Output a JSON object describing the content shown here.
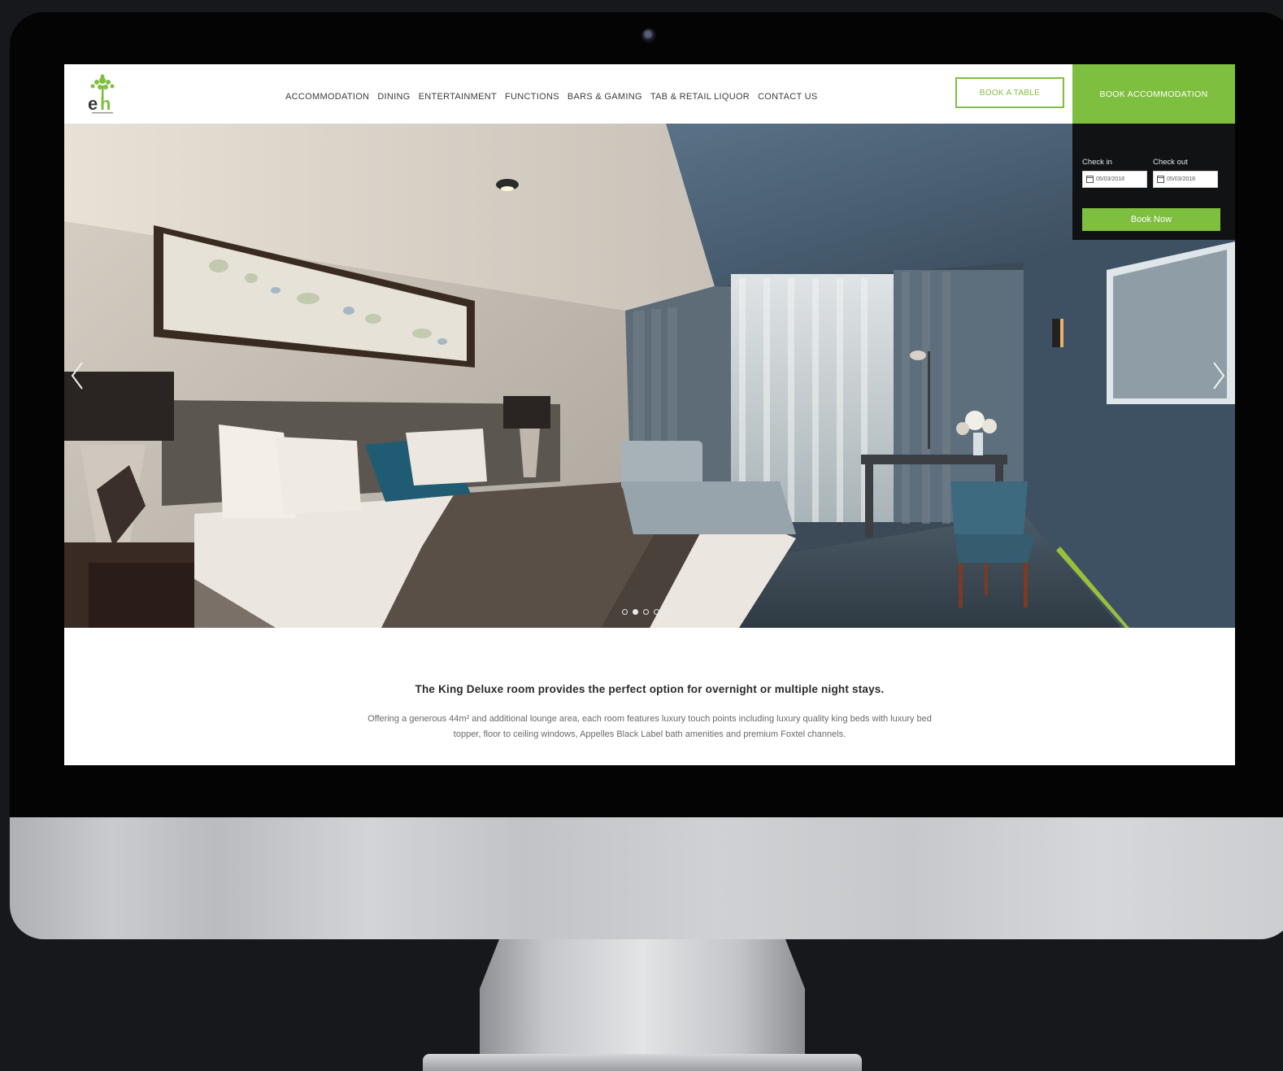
{
  "nav": {
    "items": [
      {
        "label": "ACCOMMODATION"
      },
      {
        "label": "DINING"
      },
      {
        "label": "ENTERTAINMENT"
      },
      {
        "label": "FUNCTIONS"
      },
      {
        "label": "BARS & GAMING"
      },
      {
        "label": "TAB & RETAIL LIQUOR"
      },
      {
        "label": "CONTACT US"
      }
    ]
  },
  "logo": {
    "text": "eh"
  },
  "header": {
    "book_table_label": "BOOK A TABLE",
    "book_accommodation_label": "BOOK ACCOMMODATION"
  },
  "booking": {
    "check_in_label": "Check in",
    "check_out_label": "Check out",
    "check_in_value": "05/03/2018",
    "check_out_value": "05/03/2018",
    "book_now_label": "Book Now"
  },
  "slider": {
    "dot_count": 5,
    "active_dot": 2
  },
  "content": {
    "headline": "The King Deluxe room provides the perfect option for overnight or multiple night stays.",
    "body": "Offering a generous 44m² and additional lounge area, each room features luxury touch points including luxury quality king beds with luxury bed topper, floor to ceiling windows, Appelles Black Label bath amenities and premium Foxtel channels."
  },
  "colors": {
    "accent_green": "#7fbf3f",
    "dark_panel": "#101214"
  },
  "icons": {
    "logo": "tree-logo-icon",
    "prev": "chevron-left-icon",
    "next": "chevron-right-icon",
    "calendar": "calendar-icon"
  }
}
